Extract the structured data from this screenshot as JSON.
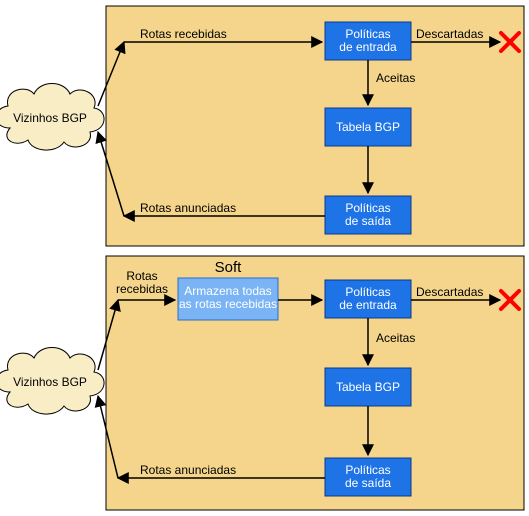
{
  "colors": {
    "panel": "#f4d58b",
    "box": "#1e73e6",
    "boxSoft": "#7ab4f5",
    "cloud": "#f9edc6",
    "discard": "#ff0000"
  },
  "common": {
    "cloud": "Vizinhos BGP",
    "policies_in": "Políticas\nde entrada",
    "policies_out": "Políticas\nde saída",
    "table": "Tabela BGP",
    "received": "Rotas recebidas",
    "received_short": "Rotas\nrecebidas",
    "advertised": "Rotas anunciadas",
    "accepted": "Aceitas",
    "discarded": "Descartadas"
  },
  "bottom": {
    "soft_title": "Soft",
    "store_all": "Armazena todas\nas rotas recebidas"
  }
}
